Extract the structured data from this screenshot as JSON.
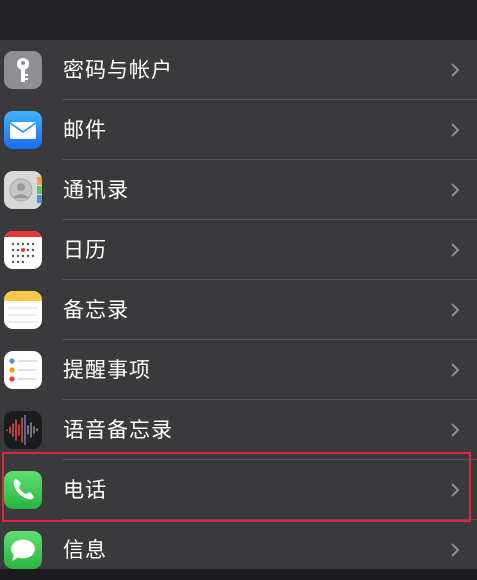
{
  "settings_list": {
    "items": [
      {
        "label": "密码与帐户",
        "icon": "key-icon"
      },
      {
        "label": "邮件",
        "icon": "mail-icon"
      },
      {
        "label": "通讯录",
        "icon": "contacts-icon"
      },
      {
        "label": "日历",
        "icon": "calendar-icon"
      },
      {
        "label": "备忘录",
        "icon": "notes-icon"
      },
      {
        "label": "提醒事项",
        "icon": "reminders-icon"
      },
      {
        "label": "语音备忘录",
        "icon": "voice-memos-icon"
      },
      {
        "label": "电话",
        "icon": "phone-icon"
      },
      {
        "label": "信息",
        "icon": "messages-icon"
      }
    ],
    "highlighted_item": "电话"
  },
  "colors": {
    "background": "#3a3a3c",
    "separator": "#545458",
    "highlight_border": "#e0263c",
    "phone_green": "#34c759",
    "mail_blue": "#2f8cff"
  }
}
